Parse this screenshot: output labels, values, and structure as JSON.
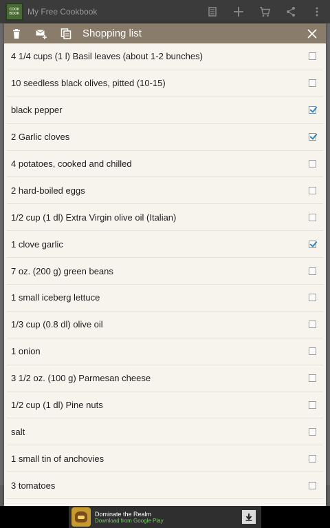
{
  "app": {
    "title": "My Free Cookbook",
    "logo_lines": [
      "COOK",
      "BOOK"
    ],
    "actions": [
      "list-icon",
      "plus-icon",
      "cart-icon",
      "share-icon",
      "overflow-icon"
    ]
  },
  "dialog": {
    "title": "Shopping list",
    "header_actions": [
      "trash-icon",
      "email-add-icon",
      "copy-icon"
    ],
    "items": [
      {
        "label": "4 1/4 cups (1 l) Basil leaves (about 1-2 bunches)",
        "checked": false
      },
      {
        "label": "10 seedless black olives, pitted (10-15)",
        "checked": false
      },
      {
        "label": "black pepper",
        "checked": true
      },
      {
        "label": "2 Garlic cloves",
        "checked": true
      },
      {
        "label": "4 potatoes, cooked and chilled",
        "checked": false
      },
      {
        "label": "2 hard-boiled eggs",
        "checked": false
      },
      {
        "label": "1/2 cup (1 dl) Extra Virgin olive oil (Italian)",
        "checked": false
      },
      {
        "label": "1 clove garlic",
        "checked": true
      },
      {
        "label": "7 oz. (200 g) green beans",
        "checked": false
      },
      {
        "label": "1 small iceberg lettuce",
        "checked": false
      },
      {
        "label": "1/3 cup (0.8 dl) olive oil",
        "checked": false
      },
      {
        "label": "1 onion",
        "checked": false
      },
      {
        "label": "3 1/2 oz. (100 g) Parmesan cheese",
        "checked": false
      },
      {
        "label": "1/2 cup (1 dl) Pine nuts",
        "checked": false
      },
      {
        "label": "salt",
        "checked": false
      },
      {
        "label": "1 small tin of anchovies",
        "checked": false
      },
      {
        "label": "3 tomatoes",
        "checked": false
      }
    ]
  },
  "ad": {
    "name": "Dominate the Realm",
    "subtitle": "Download from Google Play"
  },
  "colors": {
    "header": "#8a7c6a",
    "dialog_bg": "#f7f3ed",
    "check": "#2f86c9"
  }
}
